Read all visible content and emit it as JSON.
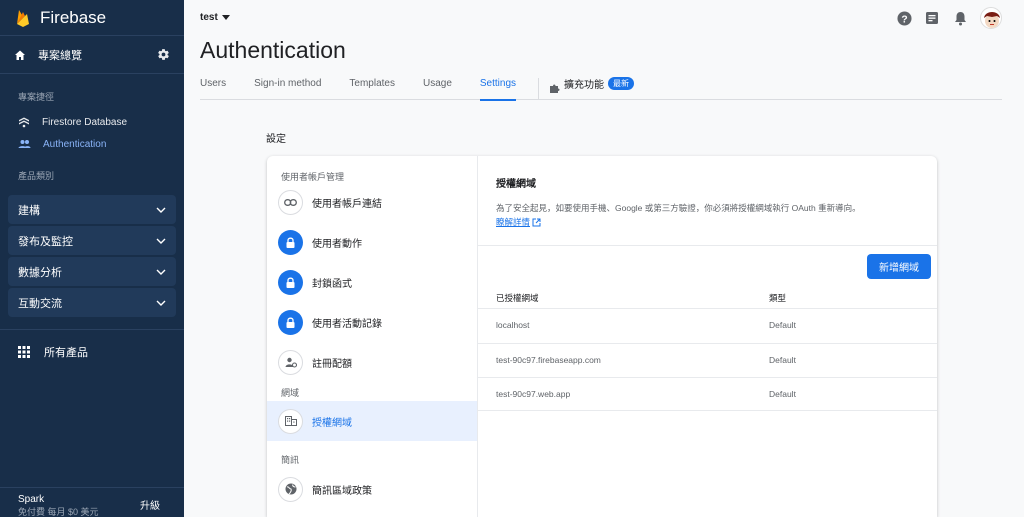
{
  "sidebar": {
    "brand": "Firebase",
    "overview_label": "專案總覽",
    "section_shortcuts": "專案捷徑",
    "shortcuts": [
      {
        "label": "Firestore Database",
        "icon": "firestore-icon"
      },
      {
        "label": "Authentication",
        "icon": "users-icon"
      }
    ],
    "section_categories": "產品類別",
    "groups": [
      {
        "label": "建構"
      },
      {
        "label": "發布及監控"
      },
      {
        "label": "數據分析"
      },
      {
        "label": "互動交流"
      }
    ],
    "all_products": "所有產品",
    "plan": "Spark",
    "plan_sub": "免付費 每月 $0 美元",
    "upgrade": "升級"
  },
  "header": {
    "project": "test",
    "title": "Authentication",
    "tabs": [
      {
        "label": "Users"
      },
      {
        "label": "Sign-in method"
      },
      {
        "label": "Templates"
      },
      {
        "label": "Usage"
      },
      {
        "label": "Settings",
        "active": true
      }
    ],
    "extensions_tab": "擴充功能",
    "extensions_badge": "最新"
  },
  "settings": {
    "heading": "設定",
    "nav": {
      "section_user": "使用者帳戶管理",
      "items_user": [
        {
          "label": "使用者帳戶連結",
          "icon": "link-icon"
        },
        {
          "label": "使用者動作",
          "icon": "lock-icon"
        },
        {
          "label": "封鎖函式",
          "icon": "lock-icon"
        },
        {
          "label": "使用者活動記錄",
          "icon": "lock-icon"
        },
        {
          "label": "註冊配額",
          "icon": "user-settings-icon"
        }
      ],
      "section_domain": "網域",
      "item_domain": "授權網域",
      "section_info": "簡訊",
      "item_info": "簡訊區域政策"
    },
    "content": {
      "title": "授權網域",
      "description": "為了安全起見，如要使用手機、Google 或第三方驗證，你必須將授權網域執行 OAuth 重新導向。",
      "learn_more": "瞭解詳情",
      "add_button": "新增網域",
      "columns": [
        "已授權網域",
        "類型"
      ],
      "rows": [
        {
          "domain": "localhost",
          "type": "Default"
        },
        {
          "domain": "test-90c97.firebaseapp.com",
          "type": "Default"
        },
        {
          "domain": "test-90c97.web.app",
          "type": "Default"
        }
      ]
    }
  },
  "colors": {
    "sidebar_bg": "#182e49",
    "accent": "#1a73e8"
  }
}
